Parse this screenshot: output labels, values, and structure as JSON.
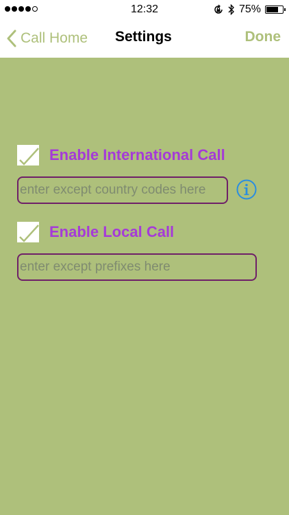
{
  "status_bar": {
    "time": "12:32",
    "battery_percent": "75%",
    "battery_level": 0.75,
    "signal_bars_filled": 4,
    "signal_bars_total": 5
  },
  "nav": {
    "back_label": "Call Home",
    "title": "Settings",
    "done_label": "Done"
  },
  "international": {
    "checked": true,
    "label": "Enable International Call",
    "placeholder": "enter except country codes here",
    "value": ""
  },
  "local": {
    "checked": true,
    "label": "Enable Local Call",
    "placeholder": "enter except prefixes here",
    "value": ""
  },
  "colors": {
    "accent": "#aec07b",
    "label": "#a53ad8",
    "field_border": "#6e1f68",
    "info": "#2a8de0"
  }
}
